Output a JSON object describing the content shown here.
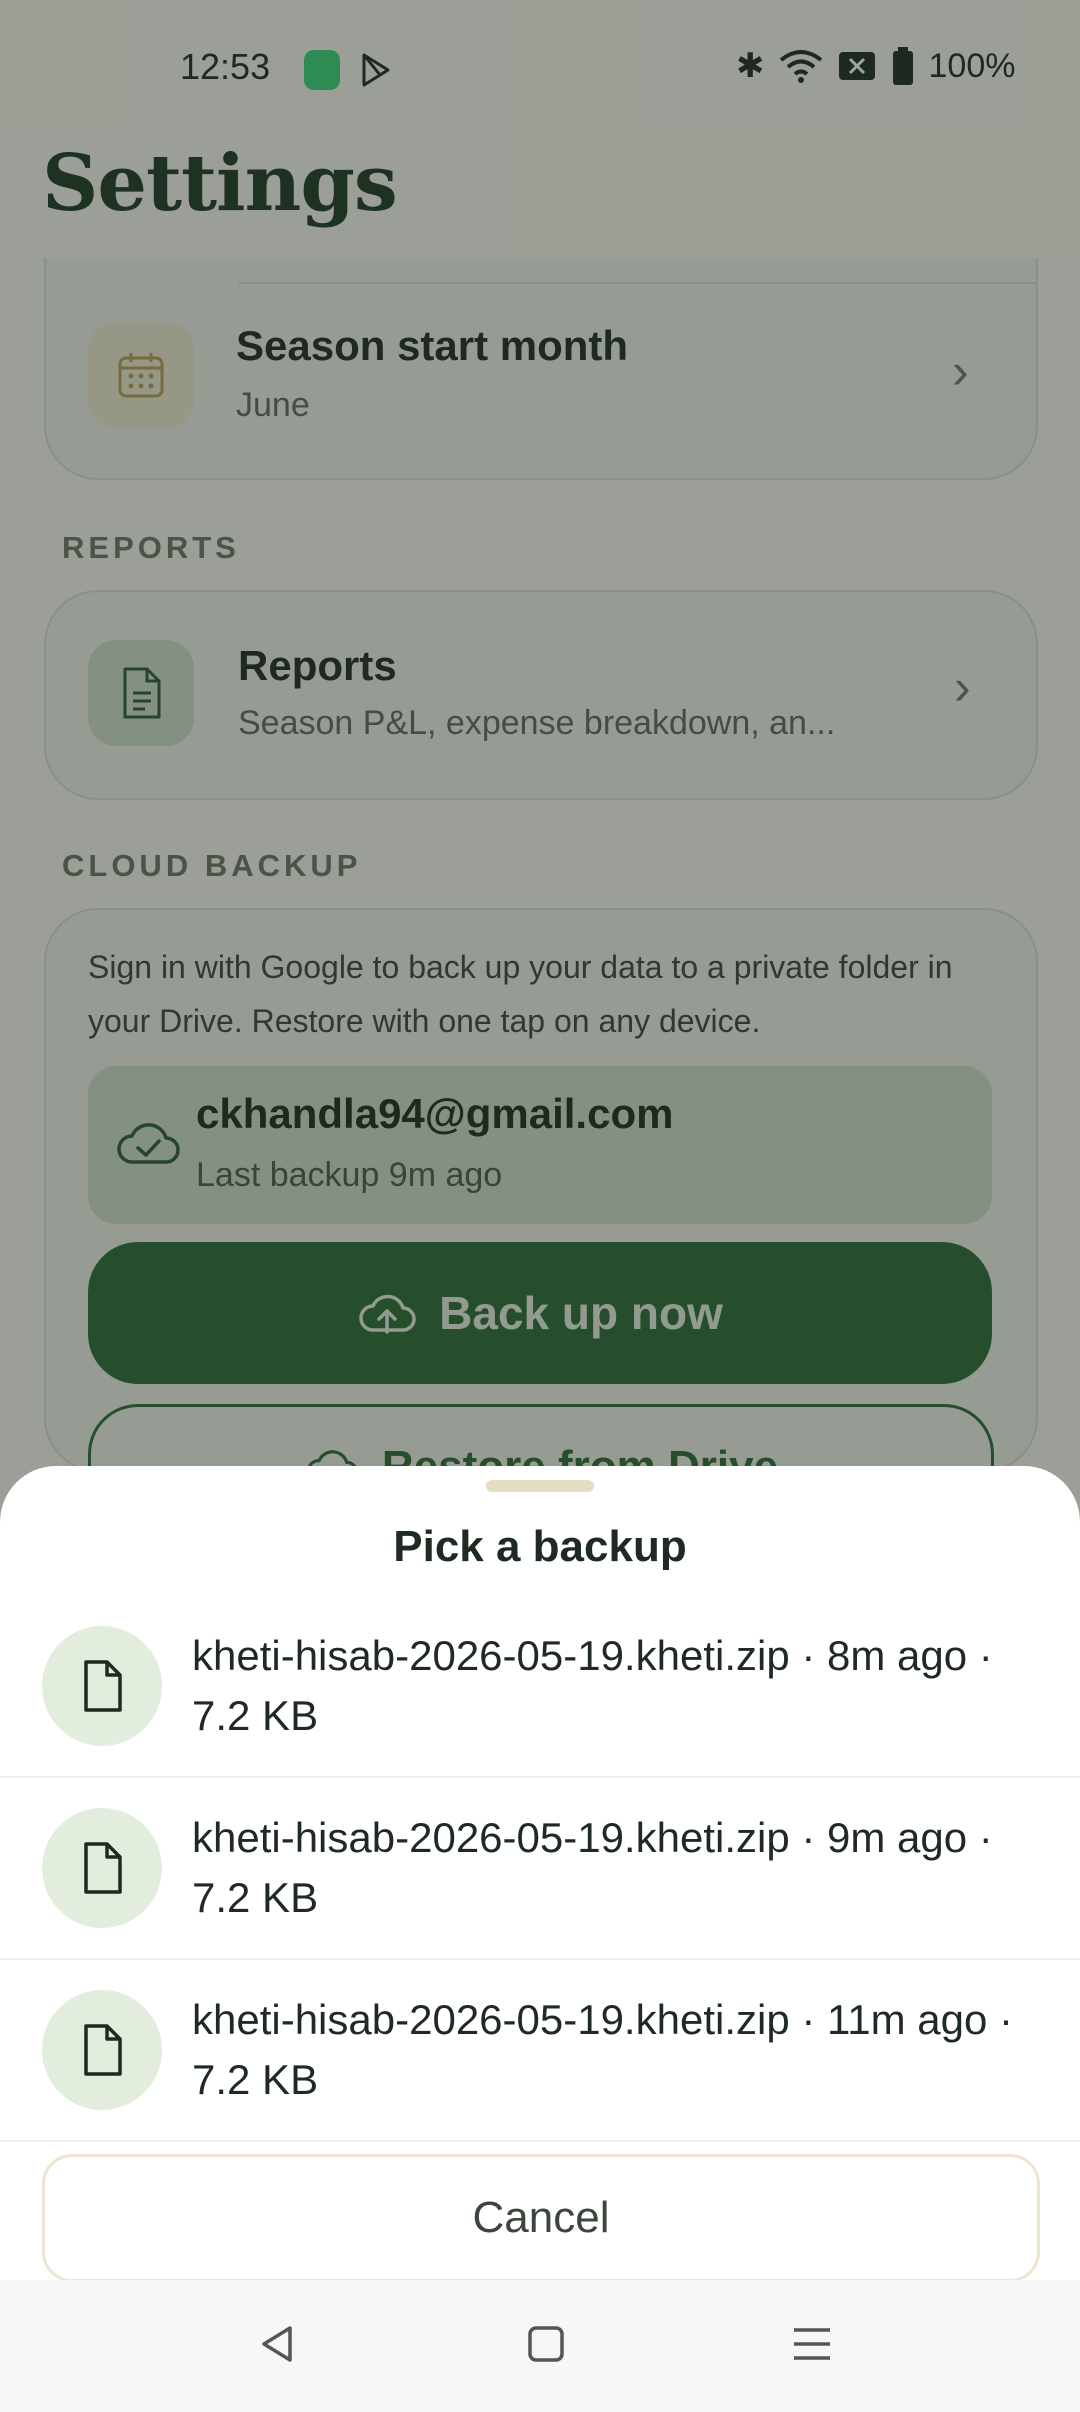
{
  "status_bar": {
    "time": "12:53",
    "battery_percent": "100%",
    "icons": [
      "battery-saver-icon",
      "play-store-icon",
      "bluetooth-icon",
      "wifi-icon",
      "no-sim-icon",
      "battery-icon"
    ]
  },
  "header": {
    "title": "Settings"
  },
  "settings": {
    "season_row": {
      "title": "Season start month",
      "value": "June",
      "icon": "calendar-icon"
    },
    "reports_section_label": "REPORTS",
    "reports_row": {
      "title": "Reports",
      "subtitle": "Season P&L, expense breakdown, an...",
      "icon": "document-icon"
    },
    "cloud_section_label": "CLOUD BACKUP",
    "cloud_description": "Sign in with Google to back up your data to a private folder in your Drive. Restore with one tap on any device.",
    "account": {
      "email": "ckhandla94@gmail.com",
      "last_backup": "Last backup 9m ago",
      "icon": "cloud-check-icon"
    },
    "backup_button_label": "Back up now",
    "restore_button_label": "Restore from Drive"
  },
  "sheet": {
    "title": "Pick a backup",
    "items": [
      {
        "label": "kheti-hisab-2026-05-19.kheti.zip  ·  8m ago  ·  7.2 KB"
      },
      {
        "label": "kheti-hisab-2026-05-19.kheti.zip  ·  9m ago  ·  7.2 KB"
      },
      {
        "label": "kheti-hisab-2026-05-19.kheti.zip  ·  11m ago  ·  7.2 KB"
      }
    ],
    "cancel_label": "Cancel"
  },
  "colors": {
    "primary": "#2d6a3a",
    "background": "#f6f5ef",
    "scrim": "rgba(28,40,28,0.42)",
    "file_avatar_bg": "#e3eddd"
  }
}
